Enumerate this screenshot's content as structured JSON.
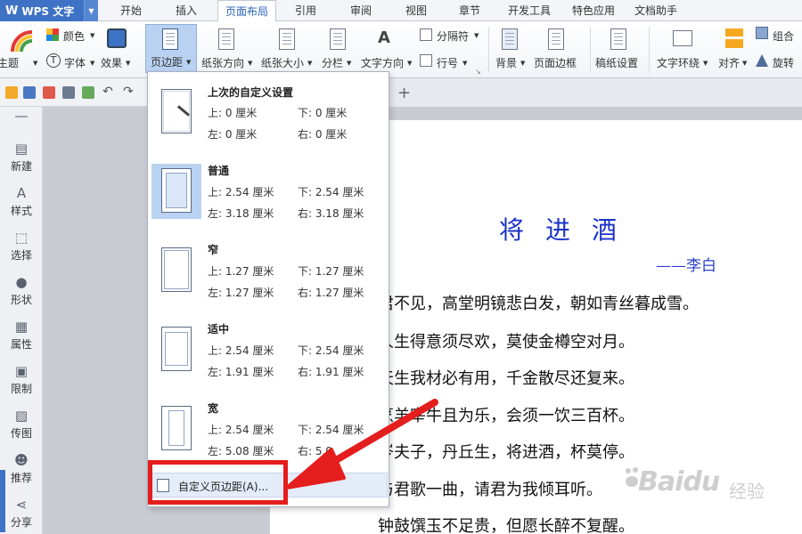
{
  "app": {
    "title": "WPS 文字",
    "logo_letter": "W"
  },
  "menu_tabs": [
    "开始",
    "插入",
    "页面布局",
    "引用",
    "审阅",
    "视图",
    "章节",
    "开发工具",
    "特色应用",
    "文档助手"
  ],
  "active_tab": "页面布局",
  "ribbon": {
    "theme": "主题",
    "color": "颜色",
    "font": "字体",
    "effect": "效果",
    "margins": "页边距",
    "orientation": "纸张方向",
    "size": "纸张大小",
    "columns": "分栏",
    "text_direction": "文字方向",
    "separator": "分隔符",
    "line_number": "行号",
    "background": "背景",
    "page_border": "页面边框",
    "manuscript": "稿纸设置",
    "wrap": "文字环绕",
    "align": "对齐",
    "group": "组合",
    "rotate": "旋转"
  },
  "sidebar": [
    "新建",
    "样式",
    "选择",
    "形状",
    "属性",
    "限制",
    "传图",
    "推荐",
    "分享"
  ],
  "margin_options": [
    {
      "name": "上次的自定义设置",
      "top": "上: 0 厘米",
      "bottom": "下: 0 厘米",
      "left": "左: 0 厘米",
      "right": "右: 0 厘米",
      "icon": "custom-last-icon"
    },
    {
      "name": "普通",
      "top": "上: 2.54 厘米",
      "bottom": "下: 2.54 厘米",
      "left": "左: 3.18 厘米",
      "right": "右: 3.18 厘米",
      "icon": "normal-margin-icon"
    },
    {
      "name": "窄",
      "top": "上: 1.27 厘米",
      "bottom": "下: 1.27 厘米",
      "left": "左: 1.27 厘米",
      "right": "右: 1.27 厘米",
      "icon": "narrow-margin-icon"
    },
    {
      "name": "适中",
      "top": "上: 2.54 厘米",
      "bottom": "下: 2.54 厘米",
      "left": "左: 1.91 厘米",
      "right": "右: 1.91 厘米",
      "icon": "moderate-margin-icon"
    },
    {
      "name": "宽",
      "top": "上: 2.54 厘米",
      "bottom": "下: 2.54 厘米",
      "left": "左: 5.08 厘米",
      "right": "右: 5.0",
      "icon": "wide-margin-icon"
    }
  ],
  "custom_margin": "自定义页边距(A)...",
  "document": {
    "title": "将进酒",
    "author": "——李白",
    "lines": [
      "君不见，高堂明镜悲白发，朝如青丝暮成雪。",
      "人生得意须尽欢，莫使金樽空对月。",
      "天生我材必有用，千金散尽还复来。",
      "烹羊宰牛且为乐，会须一饮三百杯。",
      "岑夫子，丹丘生，将进酒，杯莫停。",
      "与君歌一曲，请君为我倾耳听。",
      "钟鼓馔玉不足贵，但愿长醉不复醒。"
    ]
  },
  "watermark": {
    "text": "Baidu",
    "sub": "经验"
  },
  "colors": {
    "accent": "#3e72c4",
    "title_blue": "#1b33c7",
    "annotation_red": "#e41d1d",
    "selected_bg": "#b9d2f2"
  }
}
